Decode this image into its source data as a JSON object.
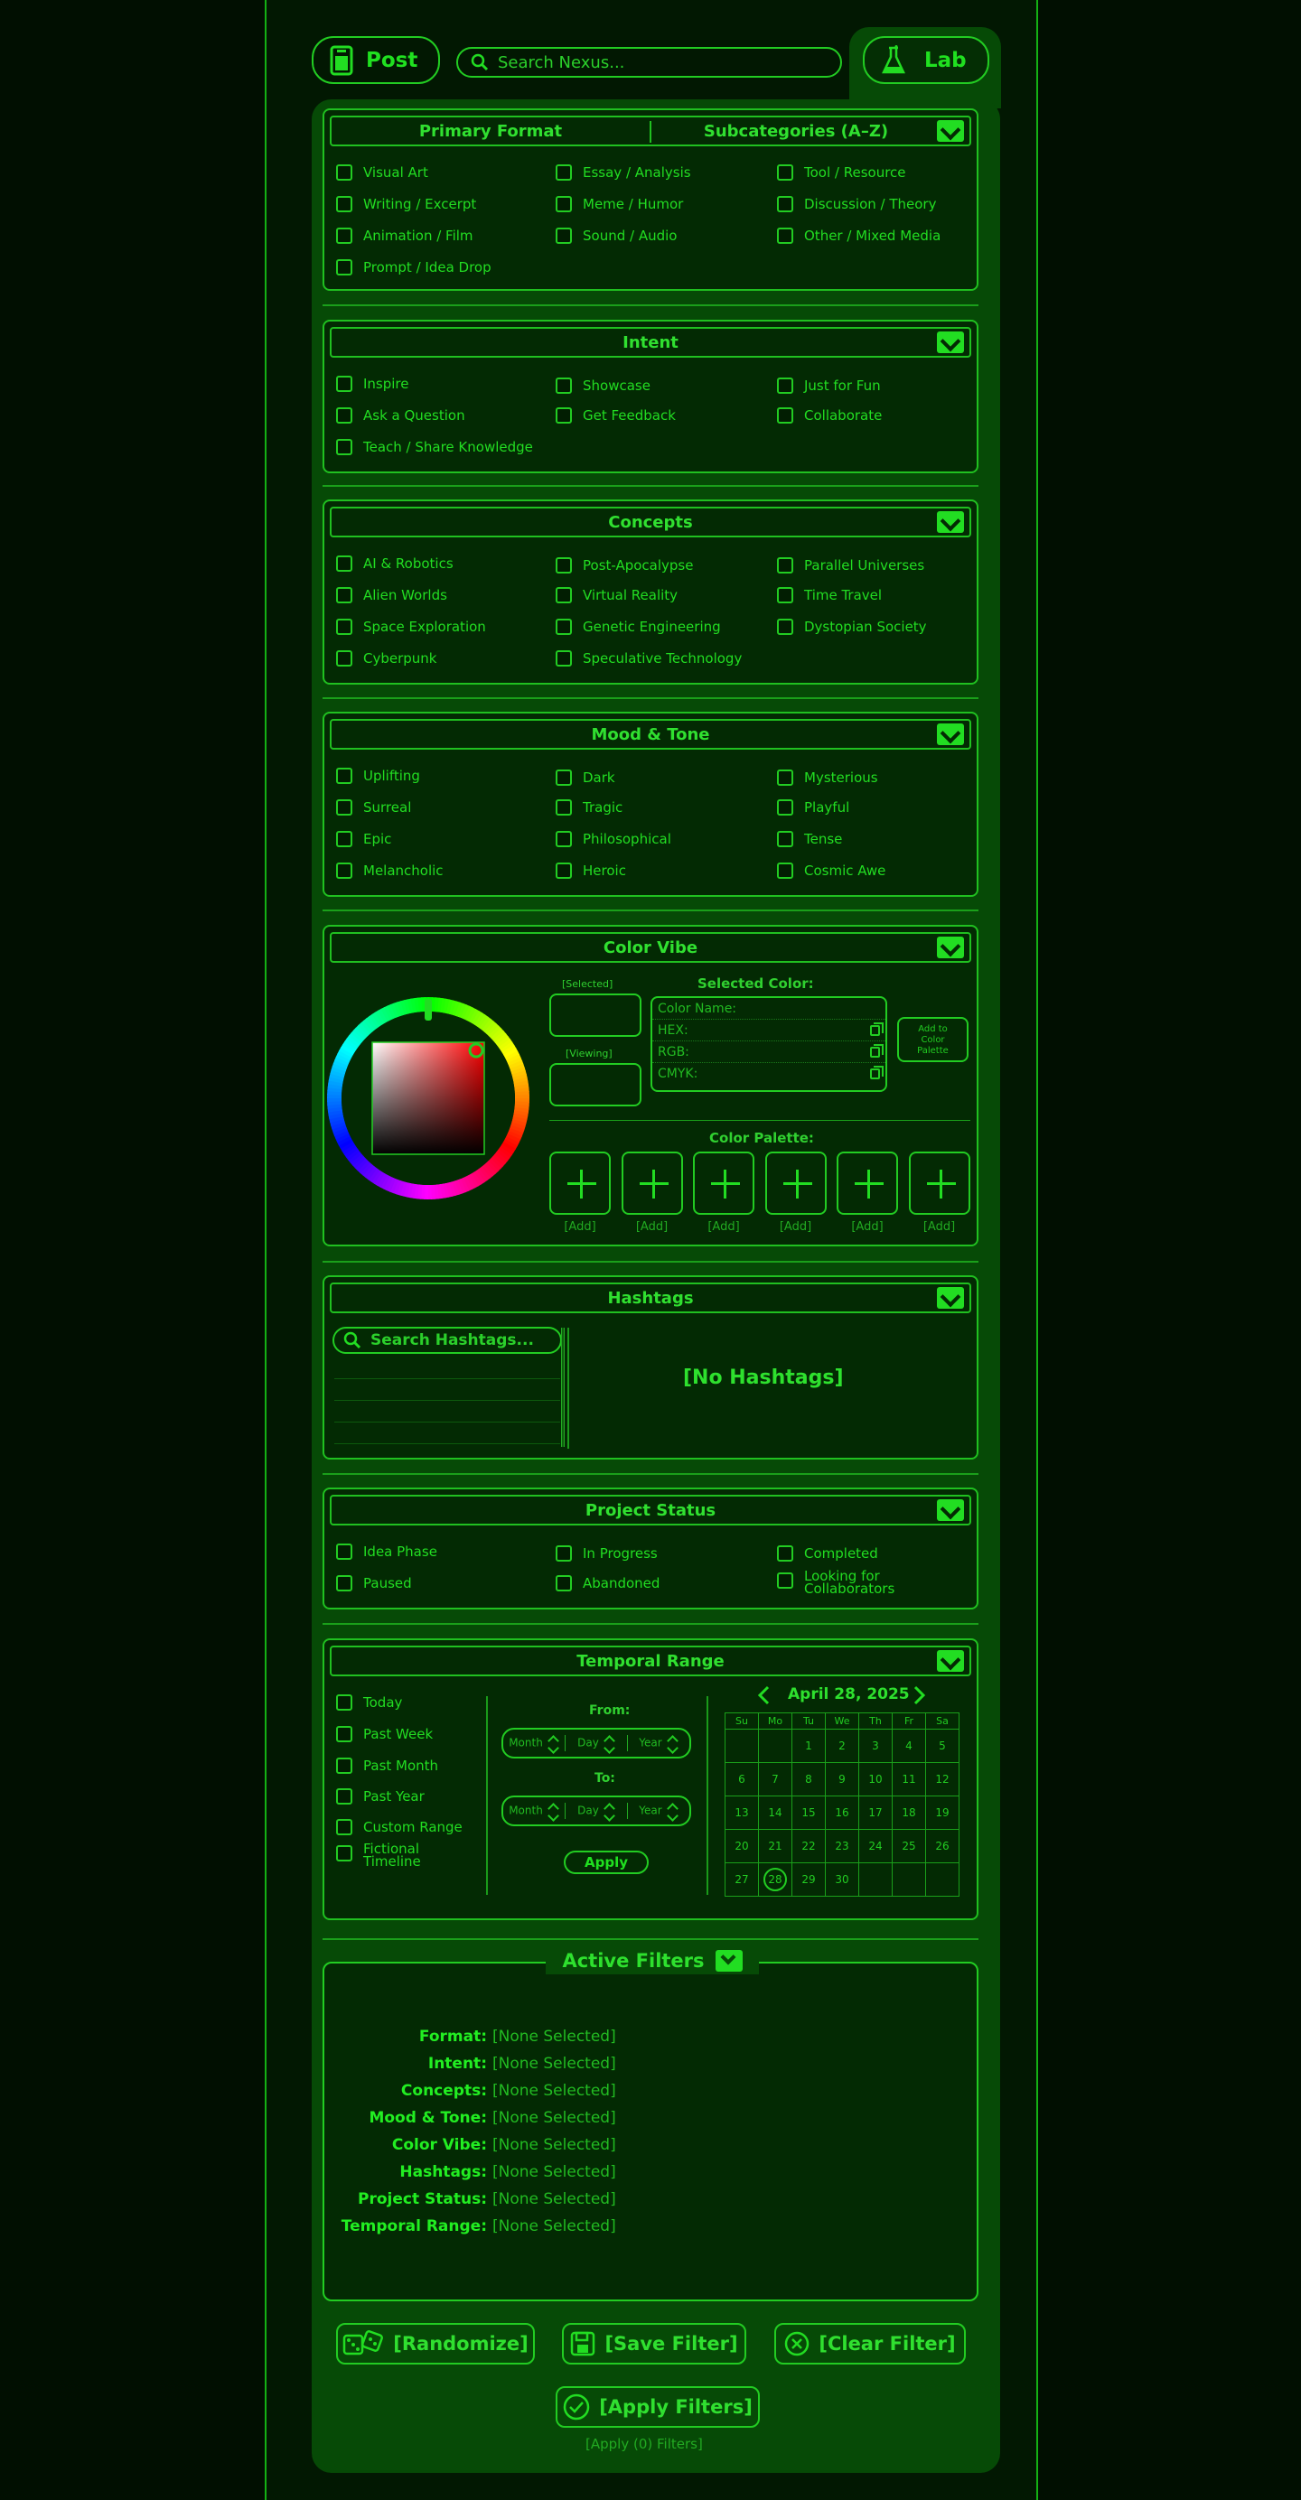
{
  "header": {
    "post_label": "Post",
    "search_placeholder": "Search Nexus...",
    "lab_label": "Lab"
  },
  "format": {
    "primary_title": "Primary Format",
    "sub_title": "Subcategories (A–Z)",
    "items": [
      "Visual Art",
      "Essay / Analysis",
      "Tool / Resource",
      "Writing / Excerpt",
      "Meme / Humor",
      "Discussion / Theory",
      "Animation / Film",
      "Sound / Audio",
      "Other / Mixed Media",
      "Prompt / Idea Drop"
    ]
  },
  "intent": {
    "title": "Intent",
    "items": [
      "Inspire",
      "Showcase",
      "Just for Fun",
      "Ask a Question",
      "Get Feedback",
      "Collaborate",
      "Teach / Share Knowledge"
    ]
  },
  "concepts": {
    "title": "Concepts",
    "items": [
      "AI & Robotics",
      "Post-Apocalypse",
      "Parallel Universes",
      "Alien Worlds",
      "Virtual Reality",
      "Time Travel",
      "Space Exploration",
      "Genetic Engineering",
      "Dystopian Society",
      "Cyberpunk",
      "Speculative Technology"
    ]
  },
  "mood": {
    "title": "Mood & Tone",
    "items": [
      "Uplifting",
      "Dark",
      "Mysterious",
      "Surreal",
      "Tragic",
      "Playful",
      "Epic",
      "Philosophical",
      "Tense",
      "Melancholic",
      "Heroic",
      "Cosmic Awe"
    ]
  },
  "color_vibe": {
    "title": "Color Vibe",
    "selected_label": "[Selected]",
    "viewing_label": "[Viewing]",
    "selected_color_title": "Selected Color:",
    "color_name_label": "Color Name:",
    "hex_label": "HEX:",
    "rgb_label": "RGB:",
    "cmyk_label": "CMYK:",
    "add_to_palette_label": "Add to Color Palette",
    "palette_title": "Color Palette:",
    "palette_slots": [
      "[Add]",
      "[Add]",
      "[Add]",
      "[Add]",
      "[Add]",
      "[Add]"
    ],
    "picker_hue": "#ff0000"
  },
  "hashtags": {
    "title": "Hashtags",
    "search_placeholder": "Search Hashtags...",
    "empty_label": "[No Hashtags]"
  },
  "project_status": {
    "title": "Project Status",
    "items": [
      "Idea Phase",
      "In Progress",
      "Completed",
      "Paused",
      "Abandoned",
      "Looking for Collaborators"
    ]
  },
  "temporal": {
    "title": "Temporal Range",
    "options": [
      "Today",
      "Past Week",
      "Past Month",
      "Past Year",
      "Custom Range",
      "Fictional Timeline"
    ],
    "from_label": "From:",
    "to_label": "To:",
    "month_label": "Month",
    "day_label": "Day",
    "year_label": "Year",
    "apply_label": "Apply",
    "calendar": {
      "month_title": "April 28, 2025",
      "weekdays": [
        "Su",
        "Mo",
        "Tu",
        "We",
        "Th",
        "Fr",
        "Sa"
      ],
      "weeks": [
        [
          "",
          "",
          "1",
          "2",
          "3",
          "4",
          "5"
        ],
        [
          "6",
          "7",
          "8",
          "9",
          "10",
          "11",
          "12"
        ],
        [
          "13",
          "14",
          "15",
          "16",
          "17",
          "18",
          "19"
        ],
        [
          "20",
          "21",
          "22",
          "23",
          "24",
          "25",
          "26"
        ],
        [
          "27",
          "28",
          "29",
          "30",
          "",
          "",
          ""
        ]
      ],
      "selected_day": "28"
    }
  },
  "active_filters": {
    "title": "Active Filters",
    "rows": [
      {
        "key": "Format:",
        "value": "[None Selected]"
      },
      {
        "key": "Intent:",
        "value": "[None Selected]"
      },
      {
        "key": "Concepts:",
        "value": "[None Selected]"
      },
      {
        "key": "Mood & Tone:",
        "value": "[None Selected]"
      },
      {
        "key": "Color Vibe:",
        "value": "[None Selected]"
      },
      {
        "key": "Hashtags:",
        "value": "[None Selected]"
      },
      {
        "key": "Project Status:",
        "value": "[None Selected]"
      },
      {
        "key": "Temporal Range:",
        "value": "[None Selected]"
      }
    ]
  },
  "actions": {
    "randomize_label": "[Randomize]",
    "save_label": "[Save Filter]",
    "clear_label": "[Clear Filter]",
    "apply_label": "[Apply Filters]",
    "apply_count_label": "[Apply (0) Filters]"
  },
  "colors": {
    "accent": "#22dd22",
    "panel": "#064a06",
    "background": "#010f01"
  }
}
